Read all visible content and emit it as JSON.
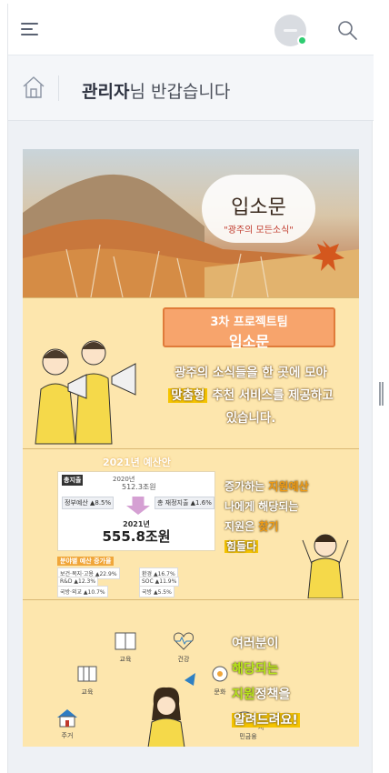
{
  "header": {
    "menu_icon": "hamburger-menu-icon",
    "avatar_icon": "user-avatar-icon",
    "avatar_status_color": "#2ecc71",
    "search_icon": "search-icon"
  },
  "greeting": {
    "home_icon": "home-icon",
    "name": "관리자",
    "suffix": "님 반갑습니다"
  },
  "banner": {
    "hero": {
      "title": "입소문",
      "subtitle": "\"광주의 모든소식\""
    },
    "intro": {
      "team_line": "3차 프로젝트팀",
      "team_name": "입소문",
      "line1": "광주의 소식들을 한 곳에 모아",
      "highlight": "맞춤형",
      "line2_rest": "추천 서비스를 제공하고",
      "line3": "있습니다."
    },
    "budget": {
      "year_heading": "2021년 예산안",
      "total_label": "총지출",
      "prev_year": "2020년",
      "prev_value": "512.3조원",
      "chip_left_label": "정부예산",
      "chip_left_value": "8.5",
      "chip_right_label": "총 재정지출",
      "chip_right_value": "1.6",
      "year": "2021년",
      "value": "555.8조원",
      "category_header": "분야별 예산 증가율",
      "categories": [
        {
          "name": "보건·복지·고용",
          "rate": "22.9"
        },
        {
          "name": "R&D",
          "rate": "12.3"
        },
        {
          "name": "국방·외교",
          "rate": "10.7"
        },
        {
          "name": "환경",
          "rate": "16.7"
        },
        {
          "name": "SOC",
          "rate": "11.9"
        },
        {
          "name": "국방",
          "rate": "5.5"
        }
      ],
      "text_line1": "증가하는",
      "text_line1_hl": "지원예산",
      "text_line2": "나에게 해당되는",
      "text_line3": "지원은",
      "text_line3_hl": "찾기",
      "text_line4": "힘들다"
    },
    "notice": {
      "icons": [
        {
          "label": "교육",
          "icon": "book-icon"
        },
        {
          "label": "건강",
          "icon": "heartbeat-icon"
        },
        {
          "label": "교육",
          "icon": "books-icon"
        },
        {
          "label": "문화",
          "icon": "culture-icon"
        },
        {
          "label": "주거",
          "icon": "house-icon"
        },
        {
          "label": "서민금융",
          "icon": "piggy-bank-icon"
        }
      ],
      "line1": "여러분이",
      "line2": "해당되는",
      "line3_hl": "지원",
      "line3_rest": "정책을",
      "line4": "알려드려요!"
    }
  }
}
